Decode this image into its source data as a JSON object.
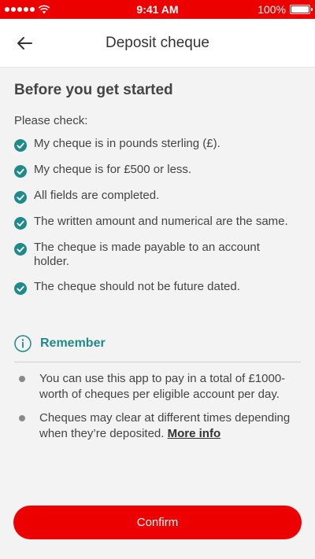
{
  "status_bar": {
    "time": "9:41 AM",
    "battery": "100%",
    "battery_level": 1.0
  },
  "header": {
    "title": "Deposit cheque",
    "back_icon": "arrow-left-icon"
  },
  "section": {
    "title": "Before you get started",
    "intro": "Please check:",
    "checks": [
      "My cheque is in pounds sterling (£).",
      "My cheque is for £500 or less.",
      "All fields are completed.",
      "The written amount and numerical are the same.",
      "The cheque is made payable to an account holder.",
      "The cheque should not be future dated."
    ]
  },
  "remember": {
    "label": "Remember",
    "bullets": [
      {
        "text": "You can use this app to pay in a total of £1000-worth of cheques per eligible account per day."
      },
      {
        "text": "Cheques may clear at different times depending when they’re deposited.",
        "link": "More info"
      }
    ]
  },
  "confirm_button": "Confirm",
  "colors": {
    "brand": "#ec0000",
    "accent": "#1f8a8a",
    "background": "#f3f3f3"
  }
}
